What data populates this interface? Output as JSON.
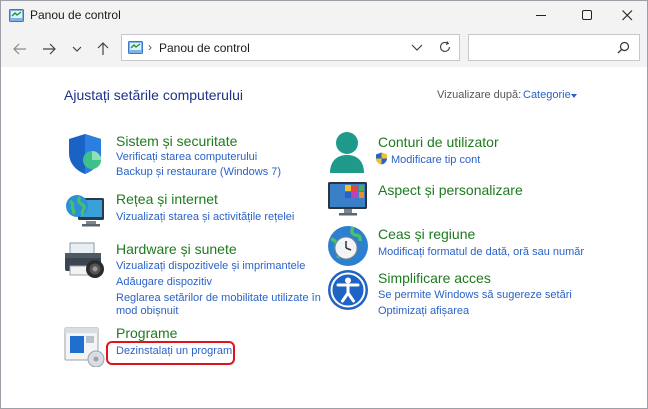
{
  "window": {
    "title": "Panou de control"
  },
  "nav": {
    "address": "Panou de control",
    "search_placeholder": ""
  },
  "header": {
    "heading": "Ajustați setările computerului",
    "view_by_label": "Vizualizare după:",
    "view_by_value": "Categorie"
  },
  "categories_left": [
    {
      "title": "Sistem și securitate",
      "icon": "shield-icon",
      "links": [
        "Verificați starea computerului",
        "Backup și restaurare (Windows 7)"
      ]
    },
    {
      "title": "Rețea și internet",
      "icon": "network-globe-icon",
      "links": [
        "Vizualizați starea și activitățile rețelei"
      ]
    },
    {
      "title": "Hardware și sunete",
      "icon": "printer-icon",
      "links": [
        "Vizualizați dispozitivele și imprimantele",
        "Adăugare dispozitiv",
        "Reglarea setărilor de mobilitate utilizate în",
        "mod obișnuit"
      ]
    },
    {
      "title": "Programe",
      "icon": "programs-icon",
      "links": [
        "Dezinstalați un program"
      ]
    }
  ],
  "categories_right": [
    {
      "title": "Conturi de utilizator",
      "icon": "user-icon",
      "links": [
        "Modificare tip cont"
      ]
    },
    {
      "title": "Aspect și personalizare",
      "icon": "monitor-icon",
      "links": []
    },
    {
      "title": "Ceas și regiune",
      "icon": "clock-globe-icon",
      "links": [
        "Modificați formatul de dată, oră sau număr"
      ]
    },
    {
      "title": "Simplificare acces",
      "icon": "accessibility-icon",
      "links": [
        "Se permite Windows să sugereze setări",
        "Optimizați afișarea"
      ]
    }
  ],
  "colors": {
    "accent_link": "#2a62c9",
    "category_title": "#1e7a1e",
    "heading": "#1e3287",
    "highlight": "#e0141e"
  }
}
